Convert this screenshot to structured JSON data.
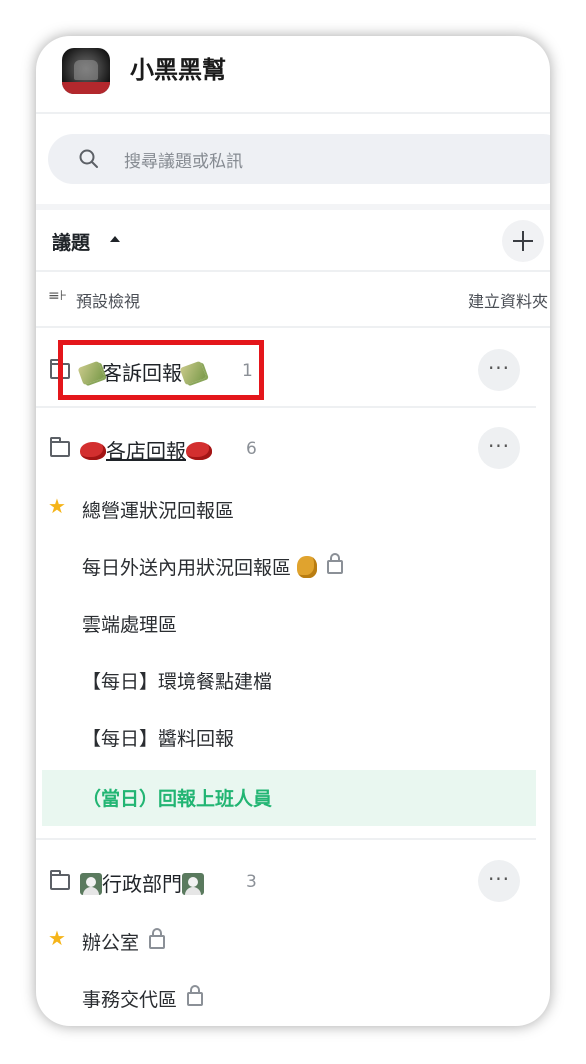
{
  "header": {
    "app_title": "小黑黑幫"
  },
  "search": {
    "placeholder": "搜尋議題或私訊"
  },
  "topics": {
    "label": "議題",
    "view_icon": "≡⊦",
    "default_view": "預設檢視",
    "create_folder": "建立資料夾"
  },
  "folders": [
    {
      "name": "客訴回報",
      "emoji": "money-with-wings",
      "count": "1"
    },
    {
      "name": "各店回報",
      "emoji": "meat",
      "count": "6",
      "channels": [
        {
          "name": "總營運狀況回報區",
          "starred": true
        },
        {
          "name": "每日外送內用狀況回報區",
          "emoji": "hand",
          "locked": true
        },
        {
          "name": "雲端處理區"
        },
        {
          "name": "【每日】環境餐點建檔"
        },
        {
          "name": "【每日】醬料回報"
        },
        {
          "name": "（當日）回報上班人員",
          "active": true
        }
      ]
    },
    {
      "name": "行政部門",
      "emoji": "person",
      "count": "3",
      "channels": [
        {
          "name": "辦公室",
          "starred": true,
          "locked": true
        },
        {
          "name": "事務交代區",
          "locked": true
        }
      ]
    }
  ],
  "colors": {
    "accent_green": "#22b573",
    "highlight_red": "#e4161b",
    "star": "#f5b419"
  }
}
